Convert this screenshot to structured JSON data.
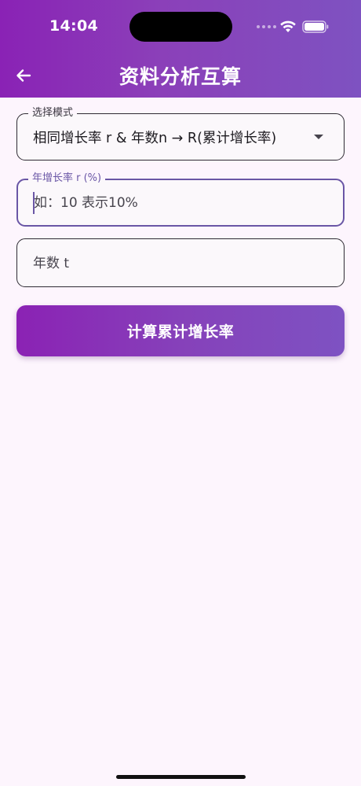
{
  "status": {
    "time": "14:04"
  },
  "app_bar": {
    "title": "资料分析互算",
    "back_icon": "arrow-left-icon"
  },
  "form": {
    "mode": {
      "label": "选择模式",
      "selected": "相同增长率 r & 年数n → R(累计增长率)"
    },
    "rate_input": {
      "label": "年增长率 r (%)",
      "placeholder": "如：10 表示10%",
      "value": ""
    },
    "years_input": {
      "placeholder": "年数 t",
      "value": ""
    },
    "submit_label": "计算累计增长率"
  },
  "colors": {
    "primary_start": "#8A22B5",
    "primary_end": "#7E52C1",
    "focus_border": "#6A56A6",
    "background": "#FDF5FD"
  }
}
